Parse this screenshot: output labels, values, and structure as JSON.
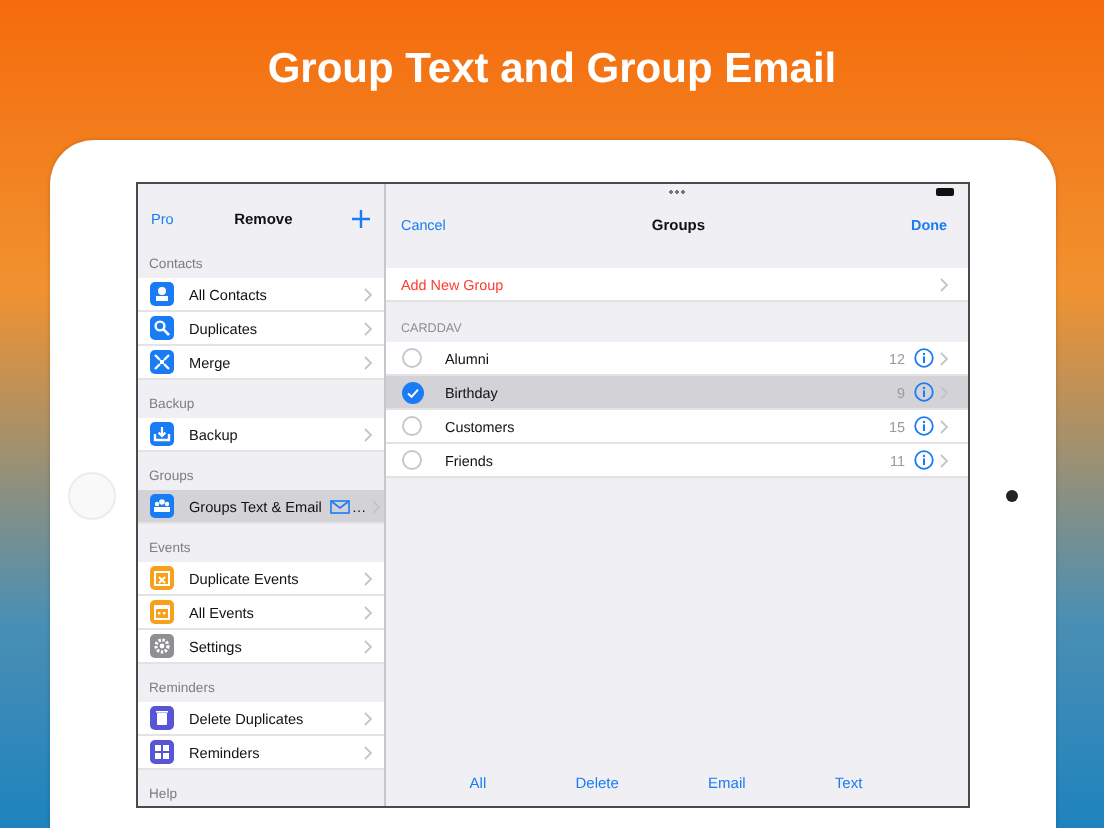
{
  "headline": "Group Text and Group Email",
  "sidebar": {
    "left_button": "Pro",
    "title": "Remove",
    "sections": [
      {
        "header": "Contacts",
        "items": [
          {
            "label": "All Contacts",
            "kind": "person",
            "color": "#1a7cf5",
            "selected": false
          },
          {
            "label": "Duplicates",
            "kind": "search",
            "color": "#1a7cf5",
            "selected": false
          },
          {
            "label": "Merge",
            "kind": "merge",
            "color": "#1a7cf5",
            "selected": false
          }
        ]
      },
      {
        "header": "Backup",
        "items": [
          {
            "label": "Backup",
            "kind": "backup",
            "color": "#1a7cf5",
            "selected": false
          }
        ]
      },
      {
        "header": "Groups",
        "items": [
          {
            "label": "Groups Text & Email",
            "kind": "group",
            "color": "#1a7cf5",
            "selected": true,
            "envelope": true,
            "trail_text": "…"
          }
        ]
      },
      {
        "header": "Events",
        "items": [
          {
            "label": "Duplicate Events",
            "kind": "calendar-x",
            "color": "#f7a11a",
            "selected": false
          },
          {
            "label": "All Events",
            "kind": "calendar",
            "color": "#f7a11a",
            "selected": false
          },
          {
            "label": "Settings",
            "kind": "gear",
            "color": "#8e8e93",
            "selected": false
          }
        ]
      },
      {
        "header": "Reminders",
        "items": [
          {
            "label": "Delete Duplicates",
            "kind": "trash",
            "color": "#5856d6",
            "selected": false
          },
          {
            "label": "Reminders",
            "kind": "list",
            "color": "#5856d6",
            "selected": false
          }
        ]
      },
      {
        "header": "Help"
      }
    ]
  },
  "groups_pane": {
    "cancel": "Cancel",
    "title": "Groups",
    "done": "Done",
    "add_row": "Add New Group",
    "section": "CARDDAV",
    "rows": [
      {
        "name": "Alumni",
        "count": "12",
        "selected": false
      },
      {
        "name": "Birthday",
        "count": "9",
        "selected": true
      },
      {
        "name": "Customers",
        "count": "15",
        "selected": false
      },
      {
        "name": "Friends",
        "count": "11",
        "selected": false
      }
    ],
    "toolbar": [
      "All",
      "Delete",
      "Email",
      "Text"
    ]
  }
}
